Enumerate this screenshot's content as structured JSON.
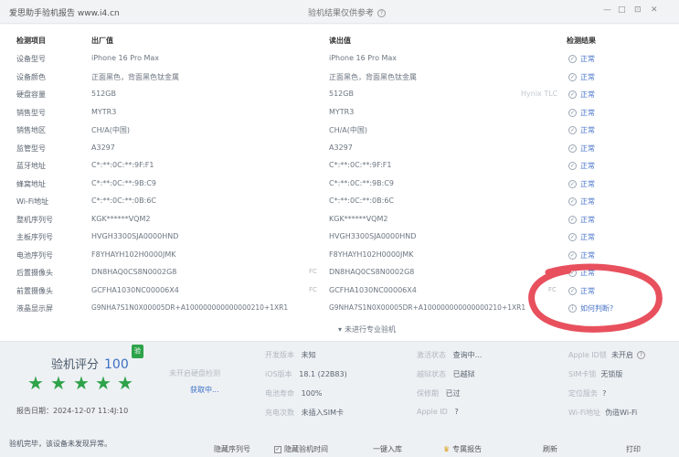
{
  "app_title": "爱思助手验机报告 www.i4.cn",
  "report_title": "验机结果仅供参考",
  "window_controls": [
    "—",
    "□",
    "⊡",
    "✕"
  ],
  "table": {
    "headers": {
      "item": "检测项目",
      "factory": "出厂值",
      "read": "读出值",
      "result": "检测结果"
    },
    "rows": [
      {
        "label": "设备型号",
        "factory": "iPhone 16 Pro Max",
        "read": "iPhone 16 Pro Max",
        "note": "",
        "result": "正常"
      },
      {
        "label": "设备颜色",
        "factory": "正面黑色，背面黑色钛金属",
        "read": "正面黑色，背面黑色钛金属",
        "note": "",
        "result": "正常"
      },
      {
        "label": "硬盘容量",
        "factory": "512GB",
        "read": "512GB",
        "note": "Hynix TLC",
        "result": "正常"
      },
      {
        "label": "销售型号",
        "factory": "MYTR3",
        "read": "MYTR3",
        "note": "",
        "result": "正常"
      },
      {
        "label": "销售地区",
        "factory": "CH/A(中国)",
        "read": "CH/A(中国)",
        "note": "",
        "result": "正常"
      },
      {
        "label": "监管型号",
        "factory": "A3297",
        "read": "A3297",
        "note": "",
        "result": "正常"
      },
      {
        "label": "蓝牙地址",
        "factory": "C*:**:0C:**:9F:F1",
        "read": "C*:**:0C:**:9F:F1",
        "note": "",
        "result": "正常"
      },
      {
        "label": "蜂窝地址",
        "factory": "C*:**:0C:**:9B:C9",
        "read": "C*:**:0C:**:9B:C9",
        "note": "",
        "result": "正常"
      },
      {
        "label": "Wi-Fi地址",
        "factory": "C*:**:0C:**:0B:6C",
        "read": "C*:**:0C:**:0B:6C",
        "note": "",
        "result": "正常"
      },
      {
        "label": "整机序列号",
        "factory": "KGK******VQM2",
        "read": "KGK******VQM2",
        "note": "",
        "result": "正常"
      },
      {
        "label": "主板序列号",
        "factory": "HVGH3300SJA0000HND",
        "read": "HVGH3300SJA0000HND",
        "note": "",
        "result": "正常"
      },
      {
        "label": "电池序列号",
        "factory": "F8YHAYH102H0000JMK",
        "read": "F8YHAYH102H0000JMK",
        "note": "",
        "result": "正常"
      },
      {
        "label": "后置摄像头",
        "factory": "DN8HAQ0CS8N0002G8",
        "read": "DN8HAQ0CS8N0002G8",
        "note": "",
        "result": "正常"
      },
      {
        "label": "前置摄像头",
        "factory": "GCFHA1030NC00006X4",
        "read": "GCFHA1030NC00006X4",
        "note": "",
        "result": "正常"
      },
      {
        "label": "液晶显示屏",
        "factory": "G9NHA7S1N0X00005DR+A100000000000000210+1XR1",
        "read": "G9NHA7S1N0X00005DR+A100000000000000210+1XR1",
        "note": "",
        "result": "如何判断?"
      }
    ],
    "pro_check": "未进行专业验机"
  },
  "score": {
    "label": "验机评分",
    "value": "100",
    "badge": "验",
    "stars": 5
  },
  "report_date": "报告日期：2024-12-07 11:4J:10",
  "waiting": {
    "text": "未开启硬盘检测",
    "sub": "获取中..."
  },
  "info_col1": [
    {
      "key": "开发版本",
      "value": "未知"
    },
    {
      "key": "iOS版本",
      "value": "18.1 (22B83)"
    },
    {
      "key": "电池寿命",
      "value": "100%"
    },
    {
      "key": "充电次数",
      "value": "未插入SIM卡"
    }
  ],
  "info_col2": [
    {
      "key": "激活状态",
      "value": "查询中..."
    },
    {
      "key": "越狱状态",
      "value": "已越狱"
    },
    {
      "key": "保修期",
      "value": "已过"
    },
    {
      "key": "Apple ID",
      "value": "?"
    }
  ],
  "info_col3": [
    {
      "key": "Apple ID锁",
      "value": "未开启"
    },
    {
      "key": "SIM卡锁",
      "value": "无锁版"
    },
    {
      "key": "定位服务",
      "value": "?"
    },
    {
      "key": "Wi-Fi地址",
      "value": "伪造Wi-Fi"
    }
  ],
  "status_text": "验机完毕，该设备未发现异常。",
  "footer": {
    "hide_sn": "隐藏序列号",
    "hide_check": "隐藏验机时间",
    "one_click": "一键入库",
    "vip": "专属报告",
    "refresh": "刷新",
    "print": "打印"
  }
}
